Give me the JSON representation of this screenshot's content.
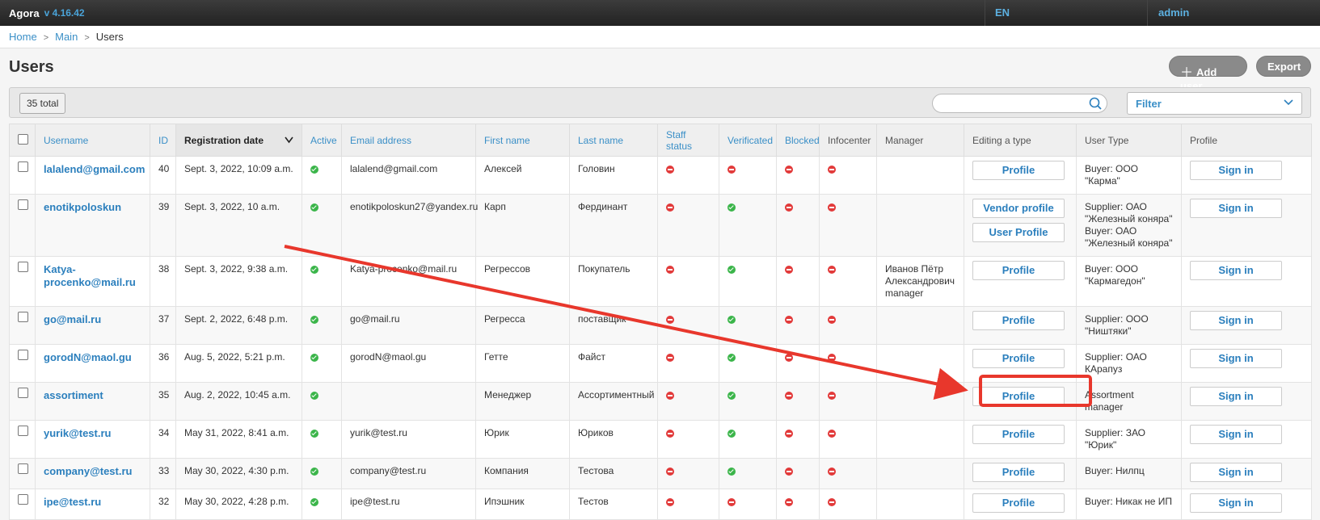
{
  "header": {
    "app": "Agora",
    "version": "v 4.16.42",
    "lang": "EN",
    "user": "admin"
  },
  "breadcrumb": [
    "Home",
    "Main",
    "Users"
  ],
  "page_title": "Users",
  "actions": {
    "add_user": "Add user",
    "export": "Export"
  },
  "toolbar": {
    "total": "35 total",
    "search_placeholder": "",
    "filter": "Filter"
  },
  "columns": [
    "Username",
    "ID",
    "Registration date",
    "Active",
    "Email address",
    "First name",
    "Last name",
    "Staff status",
    "Verificated",
    "Blocked",
    "Infocenter",
    "Manager",
    "Editing a type",
    "User Type",
    "Profile"
  ],
  "rows": [
    {
      "username": "lalalend@gmail.com",
      "id": "40",
      "date": "Sept. 3, 2022, 10:09 a.m.",
      "active": true,
      "email": "lalalend@gmail.com",
      "first": "Алексей",
      "last": "Головин",
      "staff": false,
      "verif": false,
      "blocked": false,
      "info": false,
      "manager": "",
      "profiles": [
        "Profile"
      ],
      "utype": "Buyer: ООО \"Карма\"",
      "signin": "Sign in"
    },
    {
      "username": "enotikpoloskun",
      "id": "39",
      "date": "Sept. 3, 2022, 10 a.m.",
      "active": true,
      "email": "enotikpoloskun27@yandex.ru",
      "first": "Карп",
      "last": "Фердинант",
      "staff": false,
      "verif": true,
      "blocked": false,
      "info": false,
      "manager": "",
      "profiles": [
        "Vendor profile",
        "User Profile"
      ],
      "utype": "Supplier: ОАО \"Железный коняра\" Buyer: ОАО \"Железный коняра\"",
      "signin": "Sign in"
    },
    {
      "username": "Katya-procenko@mail.ru",
      "id": "38",
      "date": "Sept. 3, 2022, 9:38 a.m.",
      "active": true,
      "email": "Katya-procenko@mail.ru",
      "first": "Регрессов",
      "last": "Покупатель",
      "staff": false,
      "verif": true,
      "blocked": false,
      "info": false,
      "manager": "Иванов Пётр Александрович manager",
      "profiles": [
        "Profile"
      ],
      "utype": "Buyer: ООО \"Кармагедон\"",
      "signin": "Sign in"
    },
    {
      "username": "go@mail.ru",
      "id": "37",
      "date": "Sept. 2, 2022, 6:48 p.m.",
      "active": true,
      "email": "go@mail.ru",
      "first": "Регресса",
      "last": "поставщик",
      "staff": false,
      "verif": true,
      "blocked": false,
      "info": false,
      "manager": "",
      "profiles": [
        "Profile"
      ],
      "utype": "Supplier: ООО \"Ништяки\"",
      "signin": "Sign in"
    },
    {
      "username": "gorodN@maol.gu",
      "id": "36",
      "date": "Aug. 5, 2022, 5:21 p.m.",
      "active": true,
      "email": "gorodN@maol.gu",
      "first": "Гетте",
      "last": "Файст",
      "staff": false,
      "verif": true,
      "blocked": false,
      "info": false,
      "manager": "",
      "profiles": [
        "Profile"
      ],
      "utype": "Supplier: ОАО КАрапуз",
      "signin": "Sign in"
    },
    {
      "username": "assortiment",
      "id": "35",
      "date": "Aug. 2, 2022, 10:45 a.m.",
      "active": true,
      "email": "",
      "first": "Менеджер",
      "last": "Ассортиментный",
      "staff": false,
      "verif": true,
      "blocked": false,
      "info": false,
      "manager": "",
      "profiles": [
        "Profile"
      ],
      "utype": "Assortment manager",
      "signin": "Sign in"
    },
    {
      "username": "yurik@test.ru",
      "id": "34",
      "date": "May 31, 2022, 8:41 a.m.",
      "active": true,
      "email": "yurik@test.ru",
      "first": "Юрик",
      "last": "Юриков",
      "staff": false,
      "verif": true,
      "blocked": false,
      "info": false,
      "manager": "",
      "profiles": [
        "Profile"
      ],
      "utype": "Supplier: ЗАО \"Юрик\"",
      "signin": "Sign in"
    },
    {
      "username": "company@test.ru",
      "id": "33",
      "date": "May 30, 2022, 4:30 p.m.",
      "active": true,
      "email": "company@test.ru",
      "first": "Компания",
      "last": "Тестова",
      "staff": false,
      "verif": true,
      "blocked": false,
      "info": false,
      "manager": "",
      "profiles": [
        "Profile"
      ],
      "utype": "Buyer: Нилпц",
      "signin": "Sign in"
    },
    {
      "username": "ipe@test.ru",
      "id": "32",
      "date": "May 30, 2022, 4:28 p.m.",
      "active": true,
      "email": "ipe@test.ru",
      "first": "Ипэшник",
      "last": "Тестов",
      "staff": false,
      "verif": false,
      "blocked": false,
      "info": false,
      "manager": "",
      "profiles": [
        "Profile"
      ],
      "utype": "Buyer: Никак не ИП",
      "signin": "Sign in"
    }
  ],
  "colors": {
    "link": "#2b7fbd",
    "ok": "#3bb54a",
    "no": "#e23a3a",
    "annotation": "#e8372c"
  }
}
